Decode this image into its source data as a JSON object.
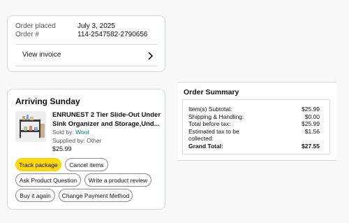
{
  "order": {
    "placed_label": "Order placed",
    "placed_value": "July 3, 2025",
    "number_label": "Order #",
    "number_value": "114-2547582-2790656",
    "invoice_label": "View invoice"
  },
  "shipment": {
    "status": "Arriving Sunday",
    "product_title_line1": "ENRUNEST 2 Tier Slide-Out Under",
    "product_title_line2": "Sink Organizer and Storage,Und...",
    "sold_by_label": "Sold by:",
    "sold_by_value": "Woot",
    "supplied_by": "Supplied by: Other",
    "price": "$25.99",
    "buttons": {
      "track": "Track package",
      "cancel": "Cancel items",
      "ask": "Ask Product Question",
      "review": "Write a product review",
      "buy_again": "Buy it again",
      "change_payment": "Change Payment Method"
    }
  },
  "summary": {
    "title": "Order Summary",
    "rows": [
      {
        "label": "Item(s) Subtotal:",
        "value": "$25.99"
      },
      {
        "label": "Shipping & Handling:",
        "value": "$0.00"
      },
      {
        "label": "Total before tax:",
        "value": "$25.99"
      },
      {
        "label": "Estimated tax to be collected:",
        "value": "$1.56"
      },
      {
        "label": "Grand Total:",
        "value": "$27.55"
      }
    ]
  },
  "colors": {
    "primary_button": "#ffd814",
    "link": "#007185",
    "border": "#d5d9d9"
  }
}
